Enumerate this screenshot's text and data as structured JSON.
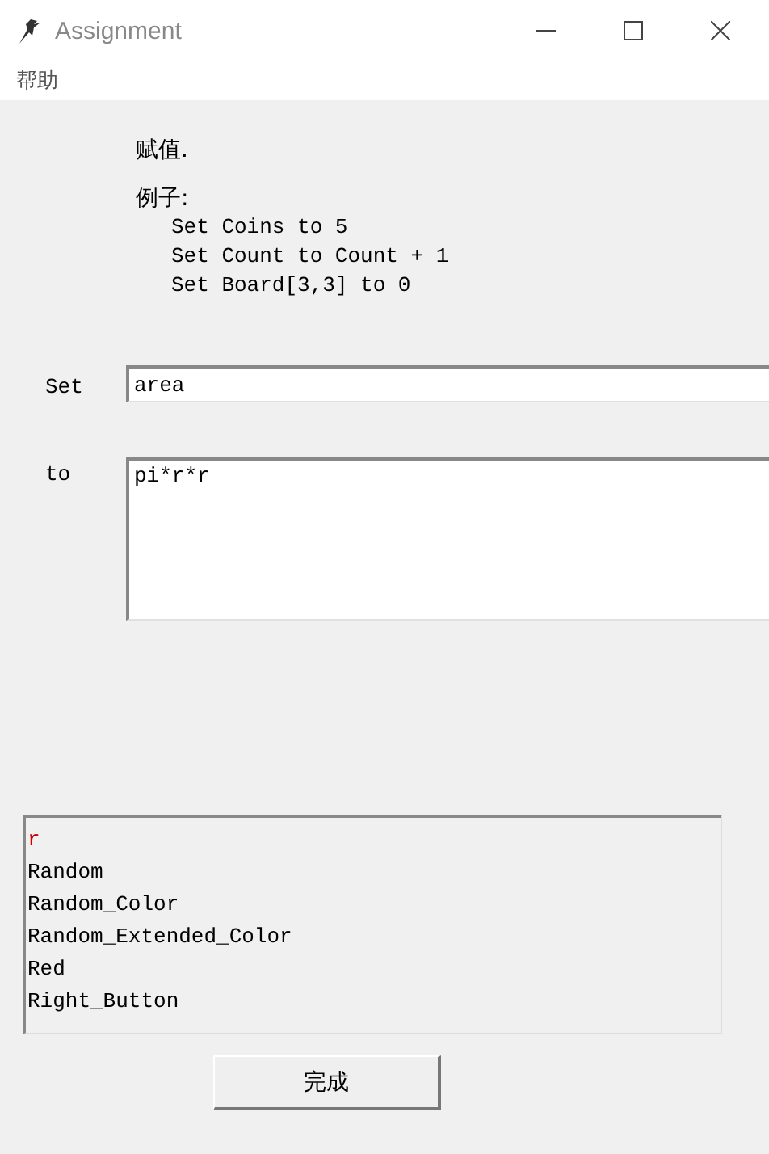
{
  "window": {
    "title": "Assignment"
  },
  "menu": [
    "帮助"
  ],
  "description": "赋值.",
  "examples": {
    "label": "例子:",
    "lines": [
      "Set Coins to 5",
      "Set Count to Count + 1",
      "Set Board[3,3] to 0"
    ]
  },
  "set_field": {
    "label": "Set",
    "value": "area"
  },
  "to_field": {
    "label": "to",
    "value": "pi*r*r"
  },
  "suggestions": [
    {
      "text": "r",
      "selected": true
    },
    {
      "text": "Random",
      "selected": false
    },
    {
      "text": "Random_Color",
      "selected": false
    },
    {
      "text": "Random_Extended_Color",
      "selected": false
    },
    {
      "text": "Red",
      "selected": false
    },
    {
      "text": "Right_Button",
      "selected": false
    }
  ],
  "buttons": [
    "完成"
  ]
}
